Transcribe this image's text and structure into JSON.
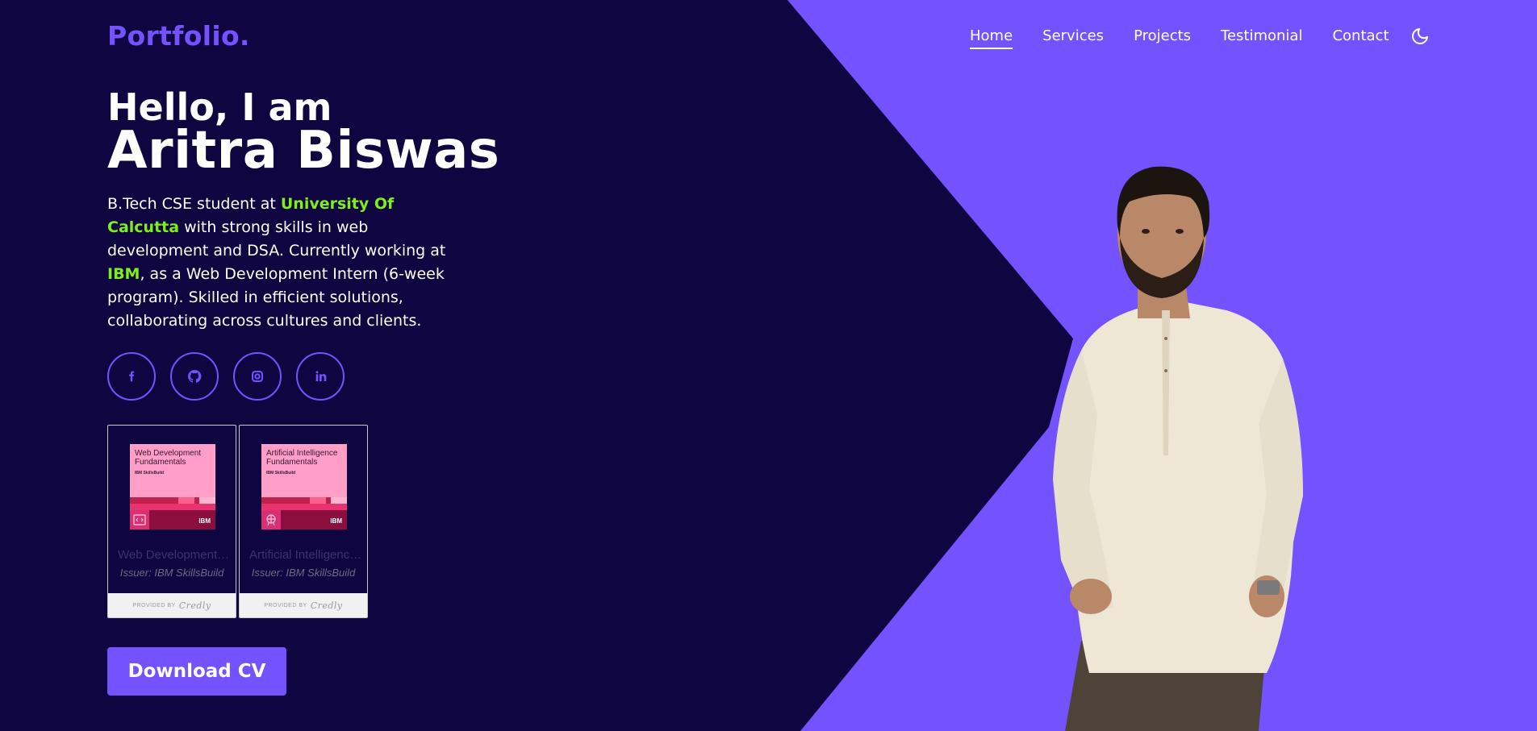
{
  "brand": {
    "logo": "Portfolio."
  },
  "nav": {
    "items": [
      {
        "label": "Home",
        "active": true
      },
      {
        "label": "Services"
      },
      {
        "label": "Projects"
      },
      {
        "label": "Testimonial"
      },
      {
        "label": "Contact"
      }
    ],
    "theme_icon": "moon-icon"
  },
  "hero": {
    "greeting": "Hello, I am",
    "name": "Aritra Biswas",
    "bio": {
      "part1": "B.Tech CSE student at ",
      "university": "University Of Calcutta",
      "part2": " with strong skills in web development and DSA. Currently working at ",
      "company": "IBM",
      "part3": ", as a Web Development Intern (6-week program). Skilled in efficient solutions, collaborating across cultures and clients."
    }
  },
  "socials": [
    {
      "icon": "facebook-icon"
    },
    {
      "icon": "github-icon"
    },
    {
      "icon": "instagram-icon"
    },
    {
      "icon": "linkedin-icon"
    }
  ],
  "badges": [
    {
      "art_title": "Web Development Fundamentals",
      "art_sub": "IBM SkillsBuild",
      "art_logo": "IBM",
      "title": "Web Development Fundamentals",
      "issuer": "Issuer: IBM SkillsBuild",
      "provided_by": "PROVIDED BY",
      "provider": "Credly"
    },
    {
      "art_title": "Artificial Intelligence Fundamentals",
      "art_sub": "IBM SkillsBuild",
      "art_logo": "IBM",
      "title": "Artificial Intelligence Fundamentals",
      "issuer": "Issuer: IBM SkillsBuild",
      "provided_by": "PROVIDED BY",
      "provider": "Credly"
    }
  ],
  "cta": {
    "download_cv": "Download CV"
  },
  "colors": {
    "background": "#0f0540",
    "accent": "#7552ff",
    "highlight": "#7cf018"
  }
}
